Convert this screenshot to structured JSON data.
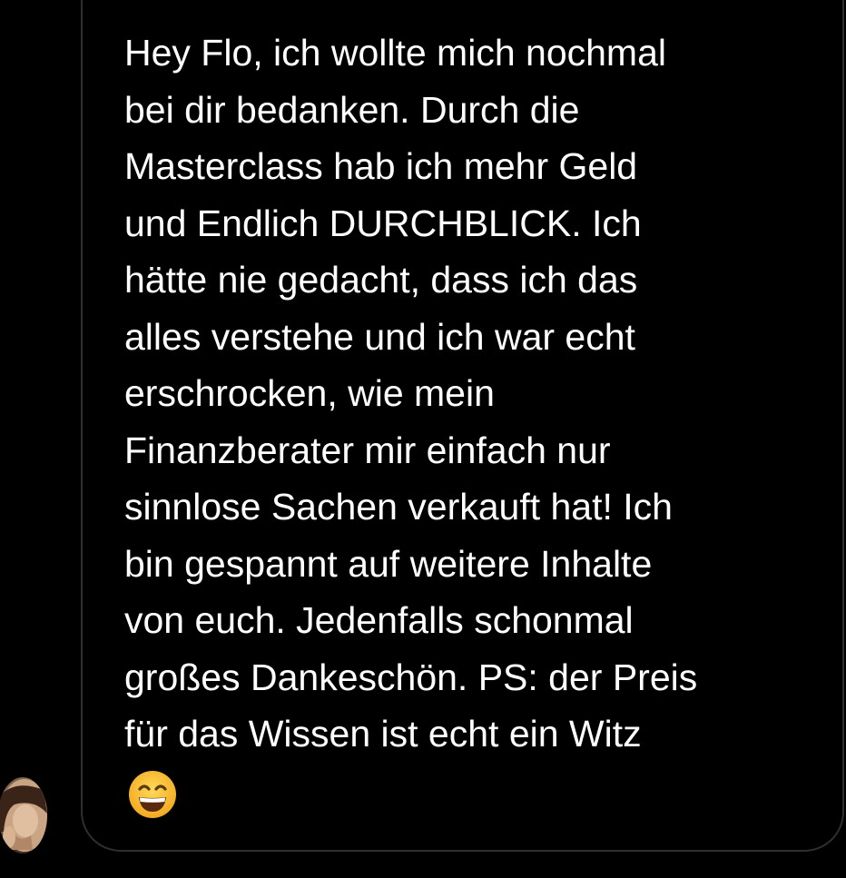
{
  "conversation": {
    "message": {
      "text": "Hey Flo, ich wollte mich nochmal\nbei dir bedanken. Durch die\nMasterclass hab ich mehr Geld\nund Endlich DURCHBLICK. Ich\nhätte nie gedacht, dass ich das\nalles verstehe und ich war echt\nerschrocken, wie mein\nFinanzberater mir einfach nur\nsinnlose Sachen verkauft hat! Ich\nbin gespannt auf weitere Inhalte\nvon euch. Jedenfalls schonmal\ngroßes Dankeschön. PS: der Preis\nfür das Wissen ist echt ein Witz",
      "emoji": "grinning-face-with-smiling-eyes-icon"
    },
    "sender": {
      "avatar": "avatar"
    }
  },
  "colors": {
    "background": "#000000",
    "bubble_border": "#2f2f2f",
    "text": "#ffffff",
    "emoji_yellow": "#f7c12b"
  }
}
